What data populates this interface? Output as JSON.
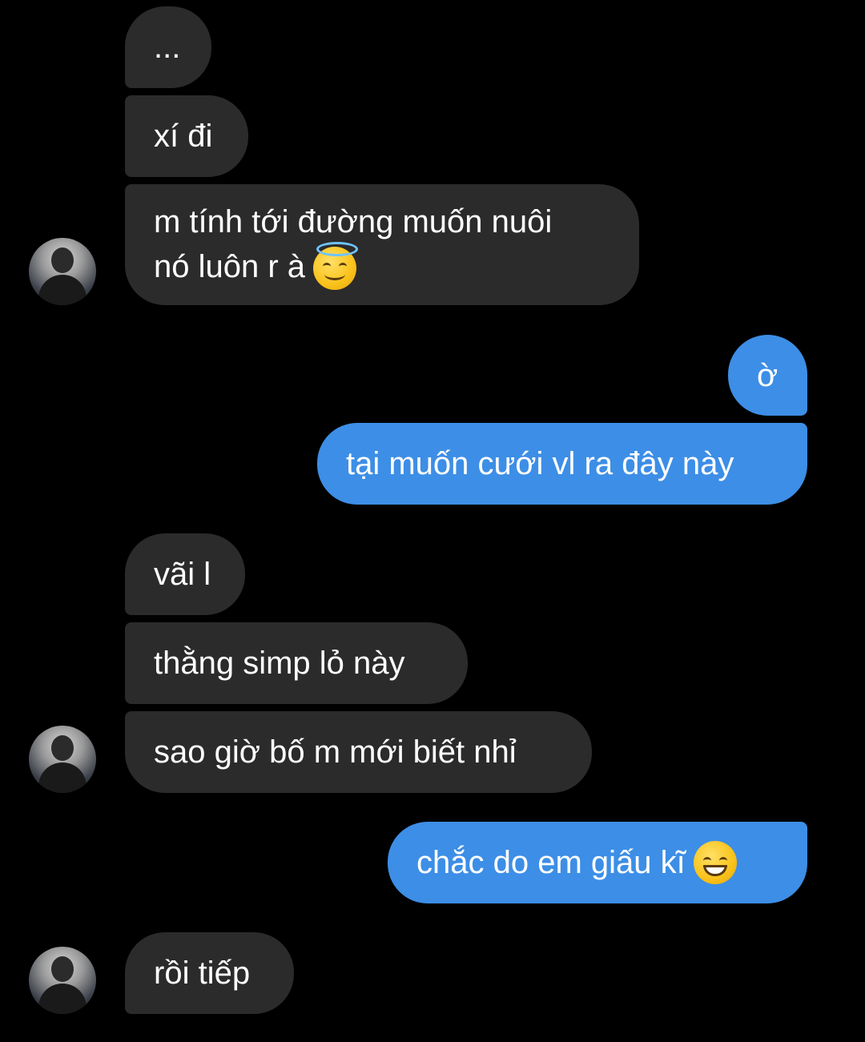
{
  "messages": [
    {
      "id": "m1",
      "side": "in",
      "text": "..."
    },
    {
      "id": "m2",
      "side": "in",
      "text": "xí đi"
    },
    {
      "id": "m3",
      "side": "in",
      "lines": [
        "m tính tới đường muốn nuôi",
        "nó luôn r à"
      ],
      "emoji": "smiling-face-with-halo"
    },
    {
      "id": "m4",
      "side": "out",
      "text": "ờ"
    },
    {
      "id": "m5",
      "side": "out",
      "text": "tại muốn cưới vl ra đây này"
    },
    {
      "id": "m6",
      "side": "in",
      "text": "vãi l"
    },
    {
      "id": "m7",
      "side": "in",
      "text": "thằng simp lỏ này"
    },
    {
      "id": "m8",
      "side": "in",
      "text": "sao giờ bố m mới biết nhỉ"
    },
    {
      "id": "m9",
      "side": "out",
      "text": "chắc do em giấu kĩ",
      "emoji": "grinning-face"
    },
    {
      "id": "m10",
      "side": "in",
      "text": "rồi tiếp"
    }
  ],
  "colors": {
    "background": "#000000",
    "incoming_bubble": "#2b2b2b",
    "outgoing_bubble": "#3d8ee6",
    "text": "#ffffff"
  }
}
